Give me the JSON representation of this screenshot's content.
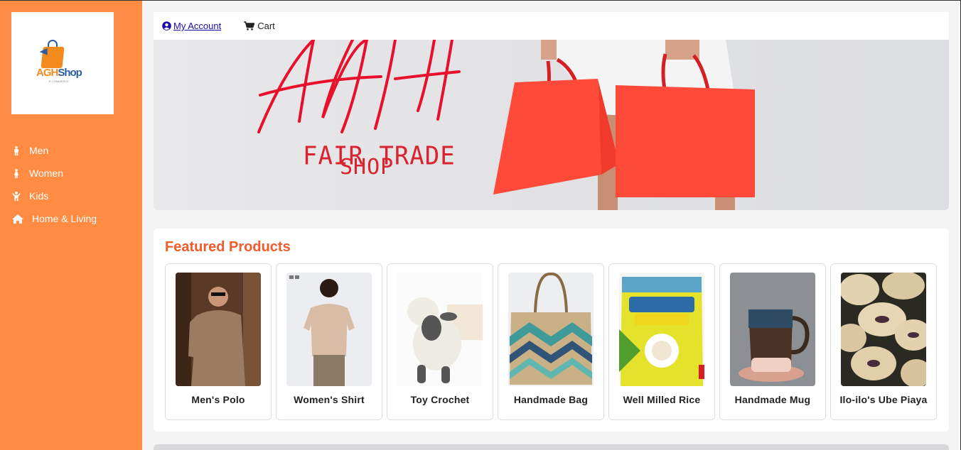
{
  "brand": {
    "logo_text_a": "AGH",
    "logo_text_b": "Shop",
    "logo_sub": "E-COMMERCE"
  },
  "sidebar": {
    "items": [
      {
        "label": "Men",
        "icon": "male-icon"
      },
      {
        "label": "Women",
        "icon": "female-icon"
      },
      {
        "label": "Kids",
        "icon": "child-icon"
      },
      {
        "label": "Home & Living",
        "icon": "home-icon"
      }
    ]
  },
  "topbar": {
    "account_label": "My Account",
    "cart_label": "Cart"
  },
  "banner": {
    "script_text": "AGH",
    "line1": "FAIR TRADE",
    "line2": "SHOP"
  },
  "featured": {
    "title": "Featured Products",
    "products": [
      {
        "name": "Men's Polo"
      },
      {
        "name": "Women's Shirt"
      },
      {
        "name": "Toy Crochet"
      },
      {
        "name": "Handmade Bag"
      },
      {
        "name": "Well Milled Rice"
      },
      {
        "name": "Handmade Mug"
      },
      {
        "name": "Ilo-ilo's Ube Piaya"
      }
    ]
  },
  "colors": {
    "sidebar": "#ff8c42",
    "accent": "#f25a29",
    "banner_red": "#d9232e"
  }
}
